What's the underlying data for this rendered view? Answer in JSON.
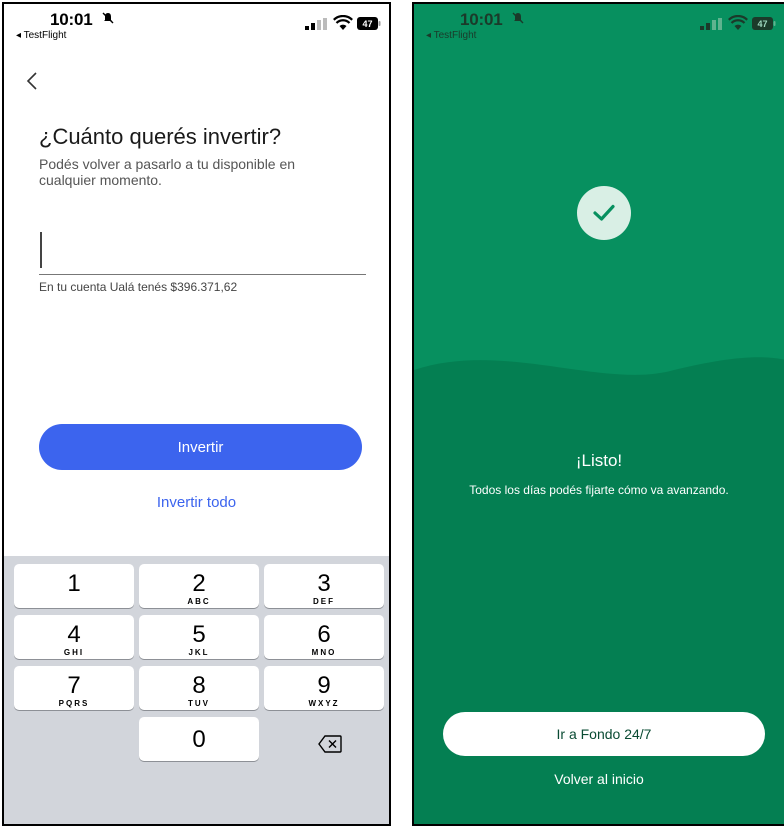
{
  "status_bar": {
    "time": "10:01",
    "back_app": "◂ TestFlight",
    "battery": "47"
  },
  "invest_screen": {
    "title": "¿Cuánto querés invertir?",
    "subtitle": "Podés volver a pasarlo a tu disponible en cualquier momento.",
    "amount_value": "",
    "balance_text": "En tu cuenta Ualá tenés $396.371,62",
    "invest_button": "Invertir",
    "invest_all_link": "Invertir todo",
    "accent_color": "#3c64ee"
  },
  "keypad": {
    "keys": [
      {
        "num": "1",
        "letters": ""
      },
      {
        "num": "2",
        "letters": "ABC"
      },
      {
        "num": "3",
        "letters": "DEF"
      },
      {
        "num": "4",
        "letters": "GHI"
      },
      {
        "num": "5",
        "letters": "JKL"
      },
      {
        "num": "6",
        "letters": "MNO"
      },
      {
        "num": "7",
        "letters": "PQRS"
      },
      {
        "num": "8",
        "letters": "TUV"
      },
      {
        "num": "9",
        "letters": "WXYZ"
      },
      {
        "num": "0",
        "letters": ""
      }
    ],
    "delete_icon": "backspace-icon"
  },
  "success_screen": {
    "title": "¡Listo!",
    "subtitle": "Todos los días podés fijarte cómo va avanzando.",
    "fund_button": "Ir a Fondo 24/7",
    "home_link": "Volver al inicio",
    "background_color": "#07905f",
    "icon": "check-icon"
  }
}
